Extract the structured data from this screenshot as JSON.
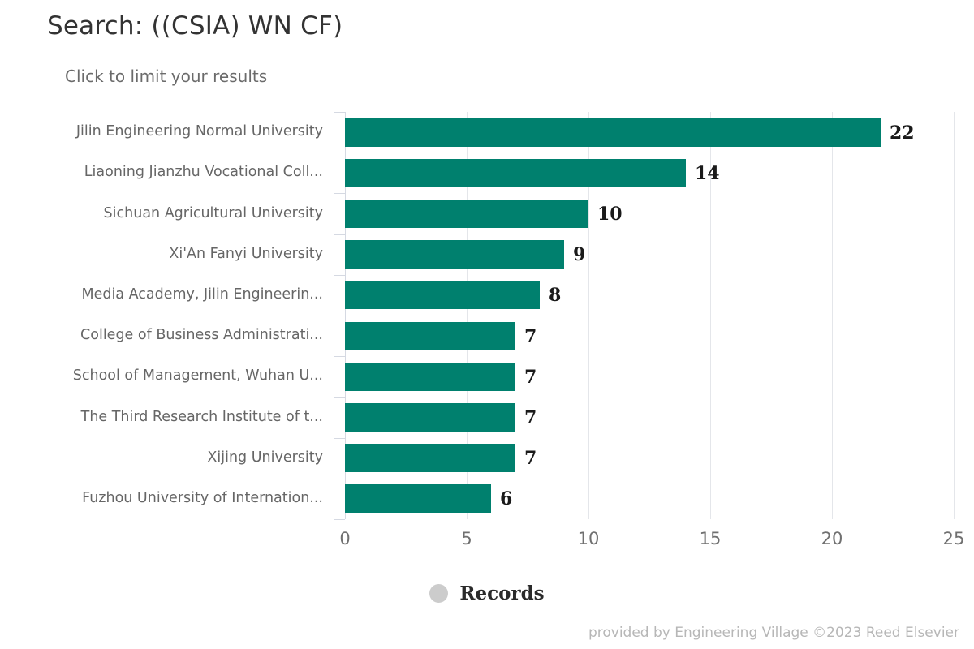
{
  "header": {
    "title": "Search: ((CSIA) WN CF)",
    "subtitle": "Click to limit your results"
  },
  "footer": {
    "text": "provided by Engineering Village ©2023 Reed Elsevier"
  },
  "legend": {
    "marker_icon": "circle-marker-icon",
    "marker_color": "#cccccc",
    "label": "Records"
  },
  "colors": {
    "bar": "#00806e",
    "gridline": "#e4e6ea",
    "axis": "#d5d9e2",
    "category_label": "#666666",
    "tick_label": "#707070",
    "title": "#333333",
    "subtitle": "#6b6b6b",
    "footer": "#b7b7b7"
  },
  "chart_data": {
    "type": "bar",
    "orientation": "horizontal",
    "title": "Search: ((CSIA) WN CF)",
    "subtitle": "Click to limit your results",
    "xlabel": "",
    "ylabel": "",
    "xlim": [
      0,
      25
    ],
    "xticks": [
      0,
      5,
      10,
      15,
      20,
      25
    ],
    "xtick_labels": [
      "0",
      "5",
      "10",
      "15",
      "20",
      "25"
    ],
    "grid": true,
    "legend_position": "bottom",
    "series": [
      {
        "name": "Records",
        "color": "#00806e",
        "values": [
          22,
          14,
          10,
          9,
          8,
          7,
          7,
          7,
          7,
          6
        ]
      }
    ],
    "categories": [
      "Jilin Engineering Normal University",
      "Liaoning Jianzhu Vocational Coll...",
      "Sichuan Agricultural University",
      "Xi'An Fanyi University",
      "Media Academy, Jilin Engineerin...",
      "College of Business Administrati...",
      "School of Management, Wuhan U...",
      "The Third Research Institute of t...",
      "Xijing University",
      "Fuzhou University of Internation..."
    ],
    "data_labels": [
      "22",
      "14",
      "10",
      "9",
      "8",
      "7",
      "7",
      "7",
      "7",
      "6"
    ]
  }
}
